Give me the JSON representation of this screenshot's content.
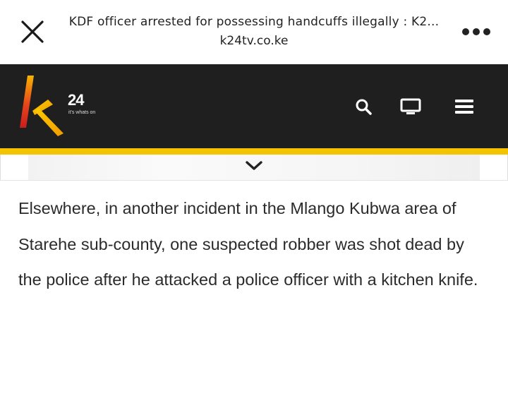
{
  "browser": {
    "title": "KDF officer arrested for possessing handcuffs illegally : K2...",
    "domain": "k24tv.co.ke",
    "close_icon": "close-icon",
    "more_icon": "more-dots-icon"
  },
  "site": {
    "logo": {
      "number": "24",
      "tagline": "it's whats on",
      "letter": "k"
    },
    "icons": [
      "search-icon",
      "tv-icon",
      "menu-icon"
    ],
    "colors": {
      "header_bg": "#1f1f1f",
      "accent": "#f5c400"
    }
  },
  "subnav": {
    "toggle_icon": "chevron-down-icon"
  },
  "article": {
    "paragraph": "Elsewhere, in another incident in the Mlango Kubwa area of Starehe sub-county, one suspected robber was shot dead by the police after he attacked a police officer with a kitchen knife."
  }
}
